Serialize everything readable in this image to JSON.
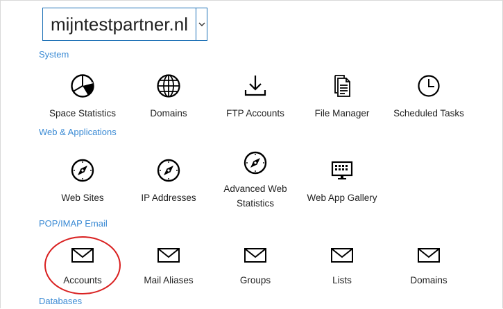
{
  "domain_selector": {
    "value": "mijntestpartner.nl"
  },
  "sections": [
    {
      "title": "System",
      "items": [
        {
          "label": "Space Statistics",
          "icon": "pie-chart-icon"
        },
        {
          "label": "Domains",
          "icon": "globe-icon"
        },
        {
          "label": "FTP Accounts",
          "icon": "download-icon"
        },
        {
          "label": "File Manager",
          "icon": "documents-icon"
        },
        {
          "label": "Scheduled Tasks",
          "icon": "clock-icon"
        }
      ]
    },
    {
      "title": "Web & Applications",
      "items": [
        {
          "label": "Web Sites",
          "icon": "compass-icon"
        },
        {
          "label": "IP Addresses",
          "icon": "compass-icon"
        },
        {
          "label": "Advanced Web Statistics",
          "icon": "compass-icon"
        },
        {
          "label": "Web App Gallery",
          "icon": "app-gallery-icon"
        }
      ]
    },
    {
      "title": "POP/IMAP Email",
      "items": [
        {
          "label": "Accounts",
          "icon": "envelope-icon"
        },
        {
          "label": "Mail Aliases",
          "icon": "envelope-icon"
        },
        {
          "label": "Groups",
          "icon": "envelope-icon"
        },
        {
          "label": "Lists",
          "icon": "envelope-icon"
        },
        {
          "label": "Domains",
          "icon": "envelope-icon"
        }
      ]
    },
    {
      "title": "Databases"
    }
  ],
  "annotation": {
    "color": "#d92020",
    "target": "Accounts"
  },
  "colors": {
    "accent": "#3a8ad4",
    "select_border": "#1a6fb5"
  }
}
